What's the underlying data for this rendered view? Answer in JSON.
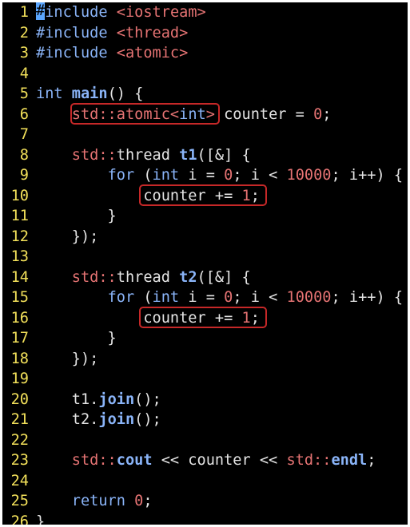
{
  "editor": {
    "lines": [
      {
        "n": "1",
        "tokens": [
          {
            "t": "#",
            "c": "cursor"
          },
          {
            "t": "include",
            "c": "kw"
          },
          {
            "t": " <iostream>",
            "c": "inc"
          }
        ]
      },
      {
        "n": "2",
        "tokens": [
          {
            "t": "#include",
            "c": "kw"
          },
          {
            "t": " <thread>",
            "c": "inc"
          }
        ]
      },
      {
        "n": "3",
        "tokens": [
          {
            "t": "#include",
            "c": "kw"
          },
          {
            "t": " <atomic>",
            "c": "inc"
          }
        ]
      },
      {
        "n": "4",
        "tokens": []
      },
      {
        "n": "5",
        "tokens": [
          {
            "t": "int",
            "c": "kw"
          },
          {
            "t": " ",
            "c": "plain"
          },
          {
            "t": "main",
            "c": "fn"
          },
          {
            "t": "() {",
            "c": "plain"
          }
        ]
      },
      {
        "n": "6",
        "tokens": [
          {
            "t": "    std::atomic<",
            "c": "ns"
          },
          {
            "t": "int",
            "c": "kw"
          },
          {
            "t": ">",
            "c": "ns"
          },
          {
            "t": " counter = ",
            "c": "plain"
          },
          {
            "t": "0",
            "c": "num"
          },
          {
            "t": ";",
            "c": "plain"
          }
        ]
      },
      {
        "n": "7",
        "tokens": []
      },
      {
        "n": "8",
        "tokens": [
          {
            "t": "    std::",
            "c": "ns"
          },
          {
            "t": "thread ",
            "c": "plain"
          },
          {
            "t": "t1",
            "c": "fn"
          },
          {
            "t": "([&] {",
            "c": "plain"
          }
        ]
      },
      {
        "n": "9",
        "tokens": [
          {
            "t": "        ",
            "c": "plain"
          },
          {
            "t": "for",
            "c": "kw"
          },
          {
            "t": " (",
            "c": "plain"
          },
          {
            "t": "int",
            "c": "kw"
          },
          {
            "t": " i = ",
            "c": "plain"
          },
          {
            "t": "0",
            "c": "num"
          },
          {
            "t": "; i < ",
            "c": "plain"
          },
          {
            "t": "10000",
            "c": "num"
          },
          {
            "t": "; i++) {",
            "c": "plain"
          }
        ]
      },
      {
        "n": "10",
        "tokens": [
          {
            "t": "            counter += ",
            "c": "plain"
          },
          {
            "t": "1",
            "c": "num"
          },
          {
            "t": ";",
            "c": "plain"
          }
        ]
      },
      {
        "n": "11",
        "tokens": [
          {
            "t": "        }",
            "c": "plain"
          }
        ]
      },
      {
        "n": "12",
        "tokens": [
          {
            "t": "    });",
            "c": "plain"
          }
        ]
      },
      {
        "n": "13",
        "tokens": []
      },
      {
        "n": "14",
        "tokens": [
          {
            "t": "    std::",
            "c": "ns"
          },
          {
            "t": "thread ",
            "c": "plain"
          },
          {
            "t": "t2",
            "c": "fn"
          },
          {
            "t": "([&] {",
            "c": "plain"
          }
        ]
      },
      {
        "n": "15",
        "tokens": [
          {
            "t": "        ",
            "c": "plain"
          },
          {
            "t": "for",
            "c": "kw"
          },
          {
            "t": " (",
            "c": "plain"
          },
          {
            "t": "int",
            "c": "kw"
          },
          {
            "t": " i = ",
            "c": "plain"
          },
          {
            "t": "0",
            "c": "num"
          },
          {
            "t": "; i < ",
            "c": "plain"
          },
          {
            "t": "10000",
            "c": "num"
          },
          {
            "t": "; i++) {",
            "c": "plain"
          }
        ]
      },
      {
        "n": "16",
        "tokens": [
          {
            "t": "            counter += ",
            "c": "plain"
          },
          {
            "t": "1",
            "c": "num"
          },
          {
            "t": ";",
            "c": "plain"
          }
        ]
      },
      {
        "n": "17",
        "tokens": [
          {
            "t": "        }",
            "c": "plain"
          }
        ]
      },
      {
        "n": "18",
        "tokens": [
          {
            "t": "    });",
            "c": "plain"
          }
        ]
      },
      {
        "n": "19",
        "tokens": []
      },
      {
        "n": "20",
        "tokens": [
          {
            "t": "    t1.",
            "c": "plain"
          },
          {
            "t": "join",
            "c": "fn"
          },
          {
            "t": "();",
            "c": "plain"
          }
        ]
      },
      {
        "n": "21",
        "tokens": [
          {
            "t": "    t2.",
            "c": "plain"
          },
          {
            "t": "join",
            "c": "fn"
          },
          {
            "t": "();",
            "c": "plain"
          }
        ]
      },
      {
        "n": "22",
        "tokens": []
      },
      {
        "n": "23",
        "tokens": [
          {
            "t": "    std::",
            "c": "ns"
          },
          {
            "t": "cout",
            "c": "fn"
          },
          {
            "t": " << counter << ",
            "c": "plain"
          },
          {
            "t": "std::",
            "c": "ns"
          },
          {
            "t": "endl",
            "c": "fn"
          },
          {
            "t": ";",
            "c": "plain"
          }
        ]
      },
      {
        "n": "24",
        "tokens": []
      },
      {
        "n": "25",
        "tokens": [
          {
            "t": "    ",
            "c": "plain"
          },
          {
            "t": "return",
            "c": "kw"
          },
          {
            "t": " ",
            "c": "plain"
          },
          {
            "t": "0",
            "c": "num"
          },
          {
            "t": ";",
            "c": "plain"
          }
        ]
      },
      {
        "n": "26",
        "tokens": [
          {
            "t": "}",
            "c": "plain"
          }
        ]
      }
    ],
    "highlights": [
      {
        "name": "highlight-atomic-declaration",
        "line": 6
      },
      {
        "name": "highlight-t1-increment",
        "line": 10
      },
      {
        "name": "highlight-t2-increment",
        "line": 16
      }
    ]
  },
  "colors": {
    "background": "#000000",
    "line_number": "#f2e05a",
    "keyword": "#8ab4f8",
    "literal": "#e57373",
    "text": "#e4e4e4",
    "cursor": "#5aa6ff",
    "highlight_border": "#c62828"
  }
}
